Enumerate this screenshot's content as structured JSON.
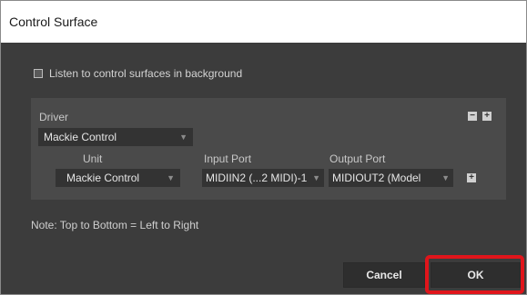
{
  "dialog": {
    "title": "Control Surface"
  },
  "background_option": {
    "label": "Listen to control surfaces in background",
    "checked": false
  },
  "driver": {
    "label": "Driver",
    "selected": "Mackie Control",
    "remove_icon": "minus-icon",
    "add_icon": "plus-icon"
  },
  "ports": {
    "unit_label": "Unit",
    "input_label": "Input Port",
    "output_label": "Output Port",
    "unit_value": "Mackie Control",
    "input_value": "MIDIIN2 (...2 MIDI)-1",
    "output_value": "MIDIOUT2 (Model",
    "add_icon": "plus-icon"
  },
  "note": "Note: Top to Bottom = Left to Right",
  "buttons": {
    "cancel": "Cancel",
    "ok": "OK"
  },
  "colors": {
    "highlight": "#e0151b",
    "background": "#3c3c3c",
    "panel": "#4a4a4a"
  }
}
